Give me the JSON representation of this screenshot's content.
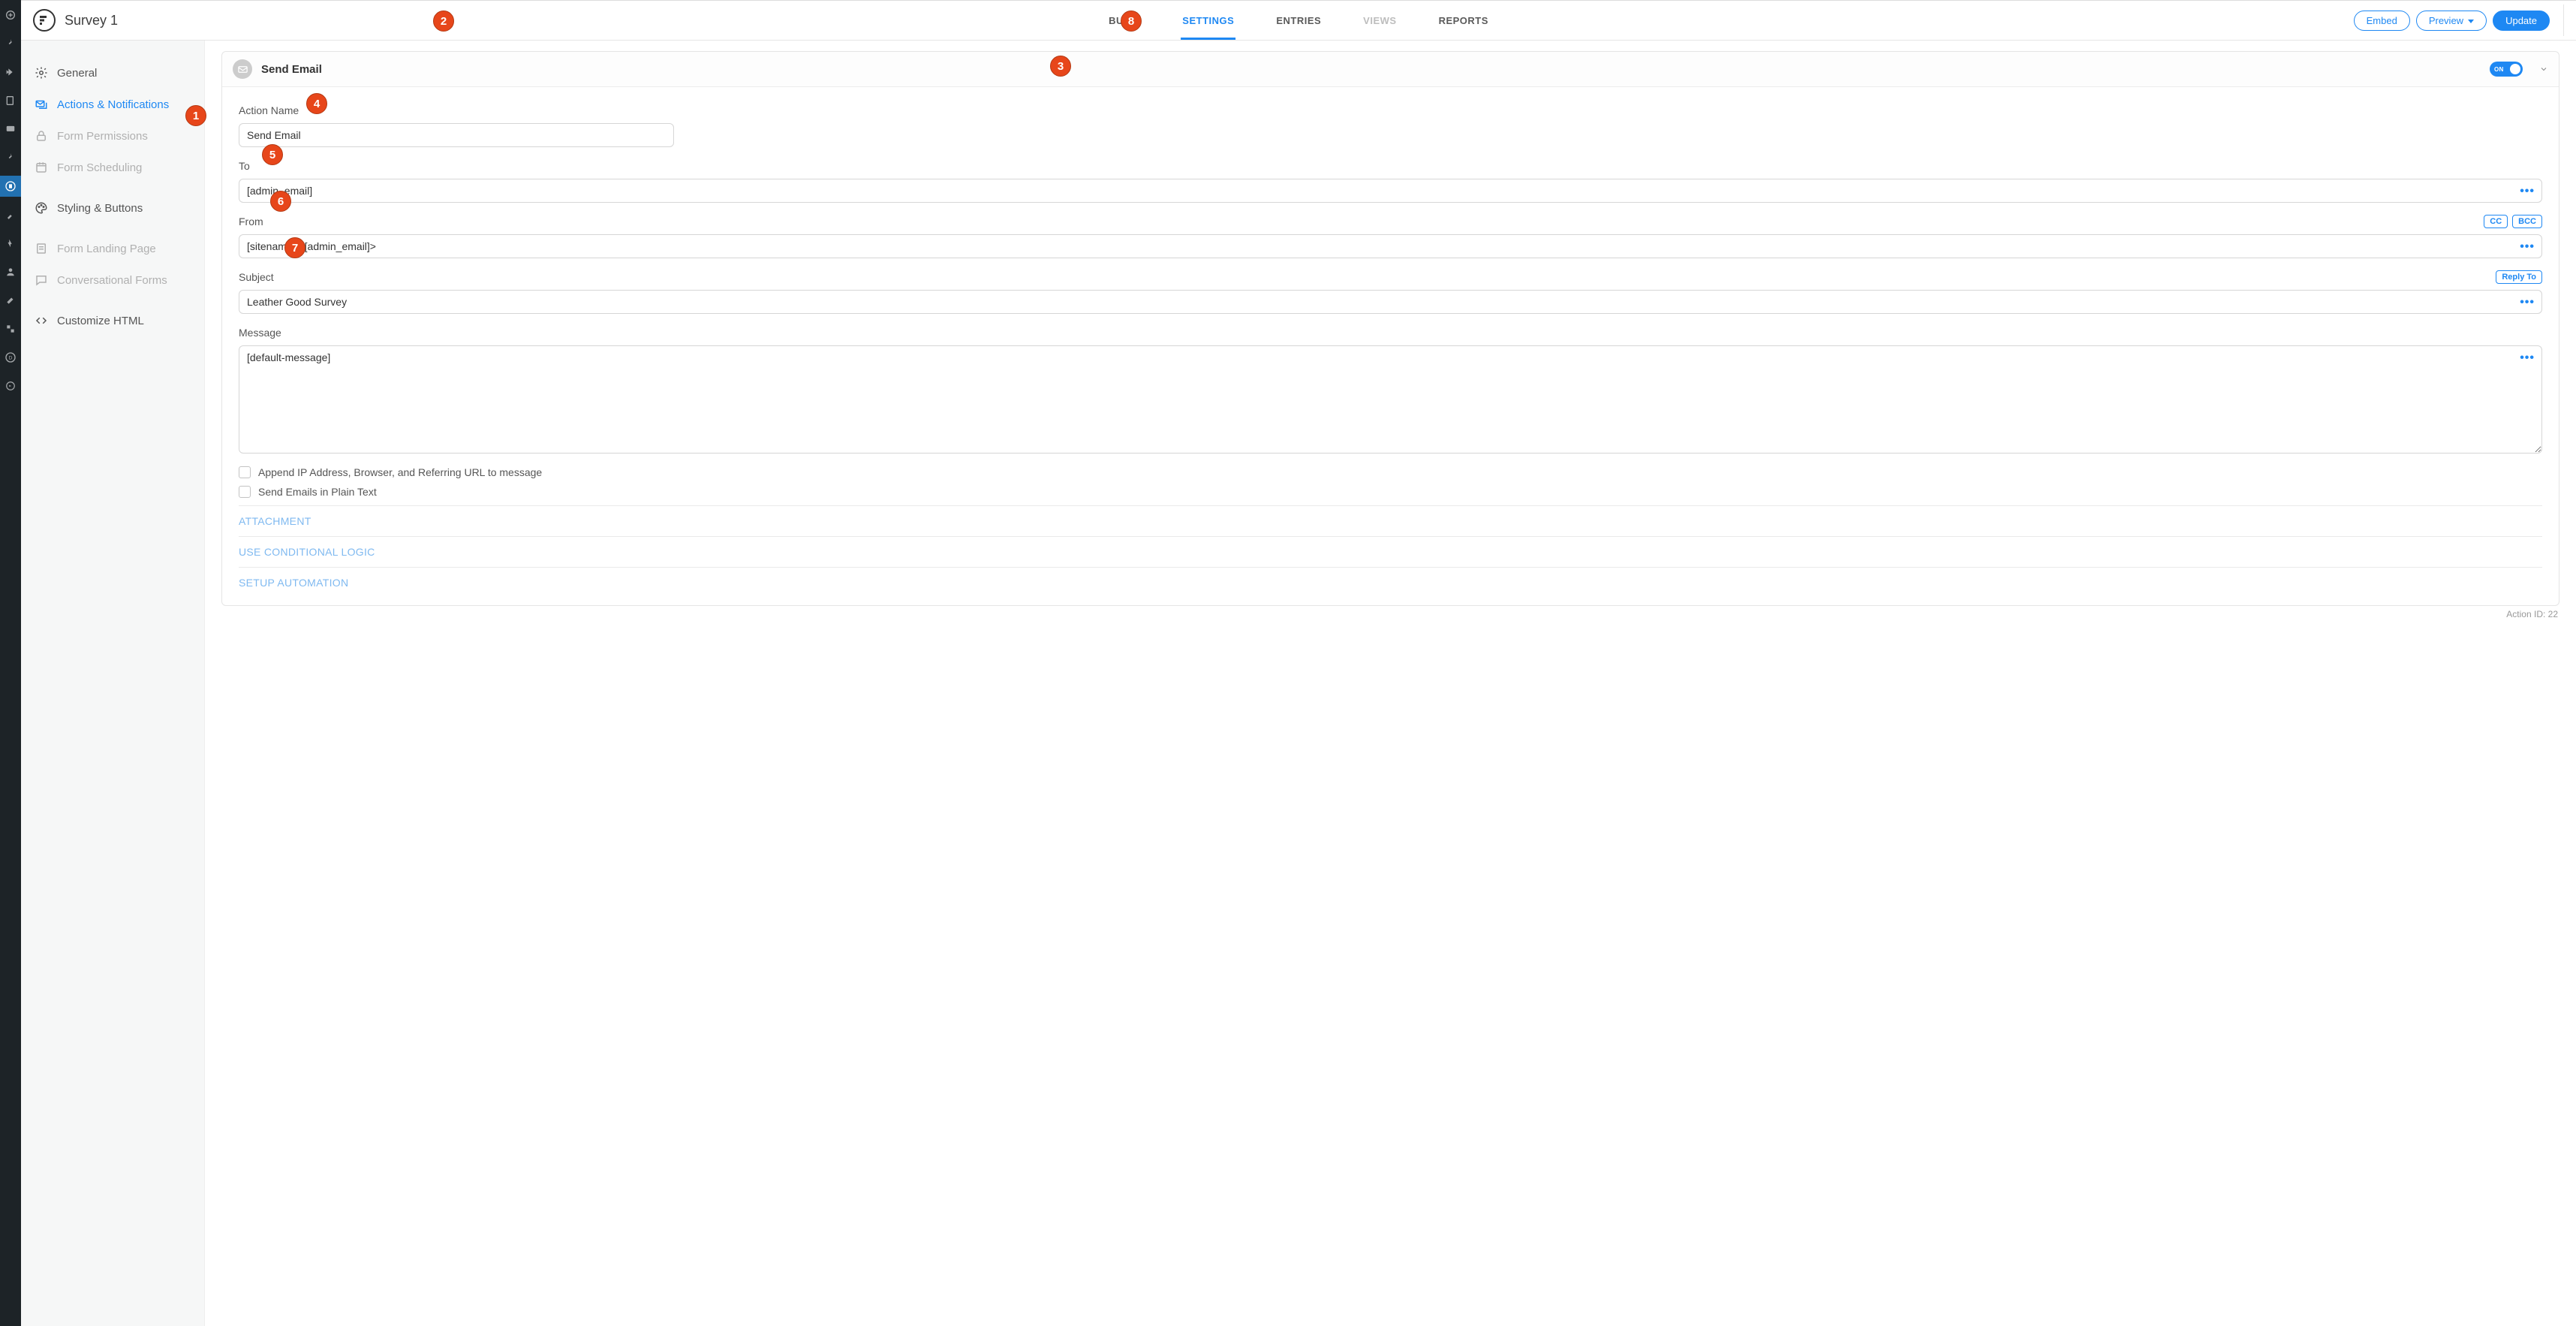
{
  "header": {
    "title": "Survey 1",
    "tabs": [
      "BUILD",
      "SETTINGS",
      "ENTRIES",
      "VIEWS",
      "REPORTS"
    ],
    "active_tab": "SETTINGS",
    "embed": "Embed",
    "preview": "Preview",
    "update": "Update"
  },
  "sidebar": {
    "items": [
      {
        "label": "General"
      },
      {
        "label": "Actions & Notifications"
      },
      {
        "label": "Form Permissions"
      },
      {
        "label": "Form Scheduling"
      },
      {
        "label": "Styling & Buttons"
      },
      {
        "label": "Form Landing Page"
      },
      {
        "label": "Conversational Forms"
      },
      {
        "label": "Customize HTML"
      }
    ]
  },
  "panel": {
    "title": "Send Email",
    "toggle": "ON",
    "fields": {
      "action_name": {
        "label": "Action Name",
        "value": "Send Email"
      },
      "to": {
        "label": "To",
        "value": "[admin_email]"
      },
      "from": {
        "label": "From",
        "value": "[sitename] <[admin_email]>",
        "cc": "CC",
        "bcc": "BCC"
      },
      "subject": {
        "label": "Subject",
        "value": "Leather Good Survey",
        "reply_to": "Reply To"
      },
      "message": {
        "label": "Message",
        "value": "[default-message]"
      }
    },
    "checks": {
      "append": "Append IP Address, Browser, and Referring URL to message",
      "plain": "Send Emails in Plain Text"
    },
    "sections": {
      "attachment": "ATTACHMENT",
      "conditional": "USE CONDITIONAL LOGIC",
      "automation": "SETUP AUTOMATION"
    },
    "action_id": "Action ID: 22"
  },
  "badges": [
    "1",
    "2",
    "3",
    "4",
    "5",
    "6",
    "7",
    "8"
  ]
}
